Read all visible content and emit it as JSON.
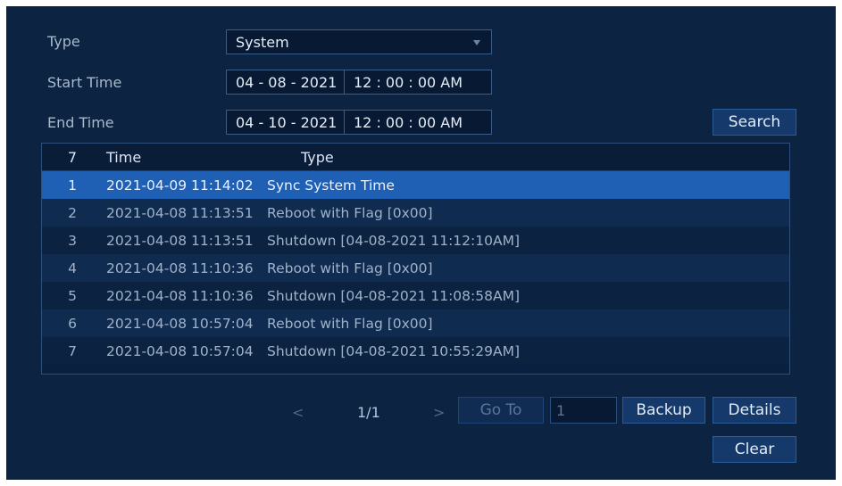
{
  "form": {
    "type_label": "Type",
    "type_value": "System",
    "start_label": "Start Time",
    "start_date": "04 - 08 - 2021",
    "start_time": "12 : 00 : 00 AM",
    "end_label": "End Time",
    "end_date": "04 - 10 - 2021",
    "end_time": "12 : 00 : 00 AM",
    "search_label": "Search"
  },
  "table": {
    "header": {
      "count": "7",
      "time": "Time",
      "type": "Type"
    },
    "rows": [
      {
        "idx": "1",
        "time": "2021-04-09 11:14:02",
        "type": "Sync System Time"
      },
      {
        "idx": "2",
        "time": "2021-04-08 11:13:51",
        "type": "Reboot with Flag [0x00]"
      },
      {
        "idx": "3",
        "time": "2021-04-08 11:13:51",
        "type": "Shutdown [04-08-2021 11:12:10AM]"
      },
      {
        "idx": "4",
        "time": "2021-04-08 11:10:36",
        "type": "Reboot with Flag [0x00]"
      },
      {
        "idx": "5",
        "time": "2021-04-08 11:10:36",
        "type": "Shutdown [04-08-2021 11:08:58AM]"
      },
      {
        "idx": "6",
        "time": "2021-04-08 10:57:04",
        "type": "Reboot with Flag [0x00]"
      },
      {
        "idx": "7",
        "time": "2021-04-08 10:57:04",
        "type": "Shutdown [04-08-2021 10:55:29AM]"
      }
    ]
  },
  "pager": {
    "prev": "<",
    "page": "1/1",
    "next": ">",
    "goto_label": "Go To",
    "goto_value": "1"
  },
  "actions": {
    "backup_label": "Backup",
    "details_label": "Details",
    "clear_label": "Clear"
  }
}
